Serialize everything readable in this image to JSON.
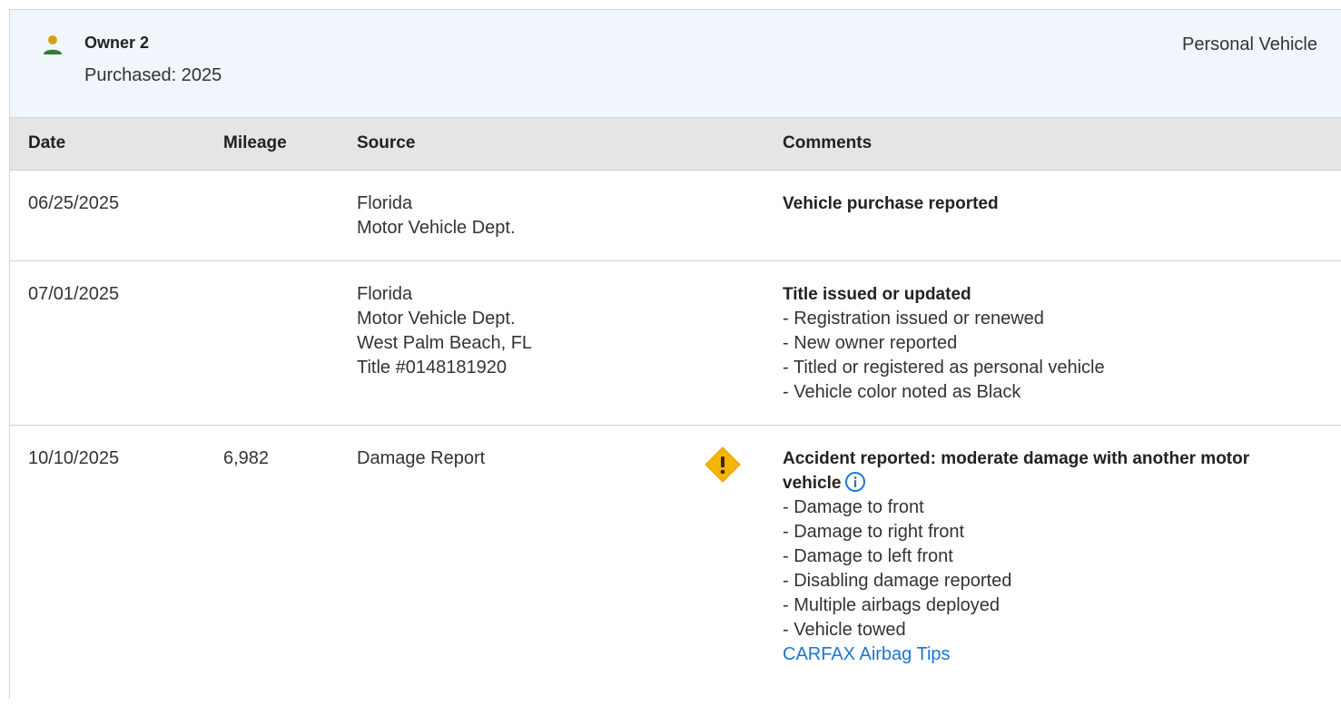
{
  "owner": {
    "name": "Owner 2",
    "purchased": "Purchased: 2025",
    "vehicle_type": "Personal Vehicle",
    "icon": "person-icon",
    "icon_color": "#2e7d32",
    "icon_head_color": "#d4a017"
  },
  "table": {
    "columns": [
      "Date",
      "Mileage",
      "Source",
      "Comments"
    ],
    "rows": [
      {
        "date": "06/25/2025",
        "mileage": "",
        "source": [
          "Florida",
          "Motor Vehicle Dept."
        ],
        "comment_title": "Vehicle purchase reported",
        "comment_lines": []
      },
      {
        "date": "07/01/2025",
        "mileage": "",
        "source": [
          "Florida",
          "Motor Vehicle Dept.",
          "West Palm Beach, FL",
          "Title #0148181920"
        ],
        "comment_title": "Title issued or updated",
        "comment_lines": [
          "- Registration issued or renewed",
          "- New owner reported",
          "- Titled or registered as personal vehicle",
          "- Vehicle color noted as Black"
        ]
      },
      {
        "date": "10/10/2025",
        "mileage": "6,982",
        "source": [
          "Damage Report"
        ],
        "warning_icon": "warning-diamond-icon",
        "warning_color": "#f5b400",
        "comment_title_line1": "Accident reported: moderate damage with another motor",
        "comment_title_line2": "vehicle",
        "info_icon": "info-circle-icon",
        "info_color": "#1976d2",
        "comment_lines": [
          "- Damage to front",
          "- Damage to right front",
          "- Damage to left front",
          "- Disabling damage reported",
          "- Multiple airbags deployed",
          "- Vehicle towed"
        ],
        "link": "CARFAX Airbag Tips"
      }
    ]
  }
}
